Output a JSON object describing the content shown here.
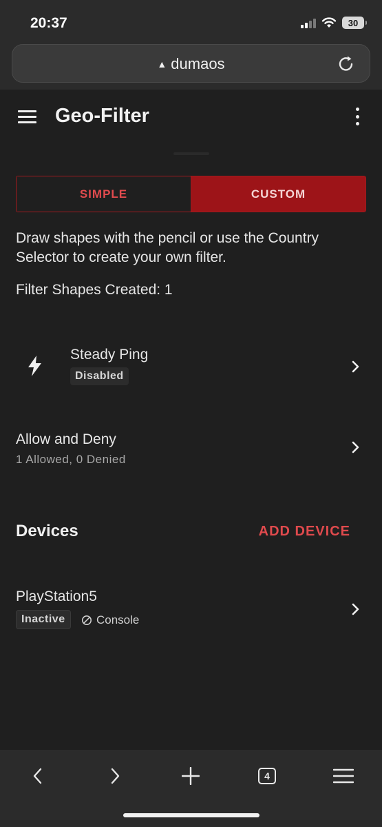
{
  "status_bar": {
    "time": "20:37",
    "battery": "30"
  },
  "browser": {
    "url": "dumaos",
    "warning_icon": "warning-triangle-icon",
    "tabs_count": "4"
  },
  "app_bar": {
    "title": "Geo-Filter"
  },
  "mode_toggle": {
    "simple": "SIMPLE",
    "custom": "CUSTOM",
    "selected": "CUSTOM"
  },
  "description": "Draw shapes with the pencil or use the Country Selector to create your own filter.",
  "shapes_created": "Filter Shapes Created: 1",
  "steady_ping": {
    "title": "Steady Ping",
    "status": "Disabled",
    "icon": "lightning-bolt-icon"
  },
  "allow_deny": {
    "title": "Allow and Deny",
    "summary": "1 Allowed, 0 Denied"
  },
  "devices": {
    "title": "Devices",
    "add_label": "ADD DEVICE",
    "items": [
      {
        "name": "PlayStation5",
        "status": "Inactive",
        "type": "Console"
      }
    ]
  },
  "colors": {
    "accent": "#e04a4d",
    "accent_dark": "#9d1418",
    "background": "#1f1f1f",
    "chrome": "#2b2b2b"
  }
}
